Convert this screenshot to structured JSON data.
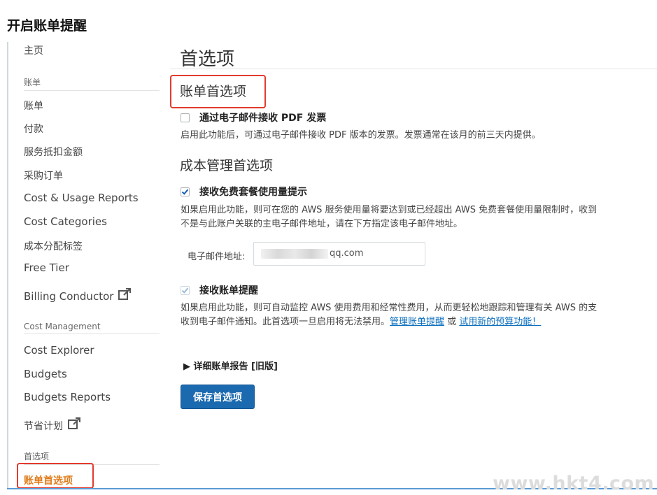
{
  "heading": "开启账单提醒",
  "sidebar": {
    "home": "主页",
    "billing_section": "账单",
    "billing_items": [
      "账单",
      "付款",
      "服务抵扣金额",
      "采购订单",
      "Cost & Usage Reports",
      "Cost Categories",
      "成本分配标签",
      "Free Tier"
    ],
    "billing_conductor": "Billing Conductor",
    "cost_mgmt_section": "Cost Management",
    "cost_mgmt_items": [
      "Cost Explorer",
      "Budgets",
      "Budgets Reports"
    ],
    "savings_plans": "节省计划",
    "preferences_section": "首选项",
    "active_item": "账单首选项"
  },
  "main": {
    "page_title": "首选项",
    "invoice_prefs": {
      "title": "账单首选项",
      "checkbox_label": "通过电子邮件接收 PDF 发票",
      "checked": false,
      "description": "启用此功能后，可通过电子邮件接收 PDF 版本的发票。发票通常在该月的前三天内提供。"
    },
    "cost_prefs": {
      "title": "成本管理首选项",
      "free_tier": {
        "label": "接收免费套餐使用量提示",
        "checked": true,
        "desc_line1": "如果启用此功能，则可在您的 AWS 服务使用量将要达到或已经超出 AWS 免费套餐使用量限制时，收到",
        "desc_line2": "不是与此账户关联的主电子邮件地址，请在下方指定该电子邮件地址。"
      },
      "email_label": "电子邮件地址:",
      "email_value": "qq.com",
      "billing_alerts": {
        "label": "接收账单提醒",
        "checked": true,
        "desc_line1": "如果启用此功能，则可自动监控 AWS 使用费用和经常性费用，从而更轻松地跟踪和管理有关 AWS 的支",
        "desc_line2_prefix": "收到电子邮件通知。此首选项一旦启用将无法禁用。",
        "link_manage": "管理账单提醒",
        "or_text": " 或 ",
        "link_budget": "试用新的预算功能！"
      }
    },
    "detailed_report": "详细账单报告 [旧版]",
    "save_button": "保存首选项"
  },
  "watermark": "www.hkt4.com",
  "colors": {
    "accent_orange": "#e07b1a",
    "primary_button": "#1b6ab0",
    "link": "#0a6ebd",
    "highlight_box": "#e33b2e"
  }
}
